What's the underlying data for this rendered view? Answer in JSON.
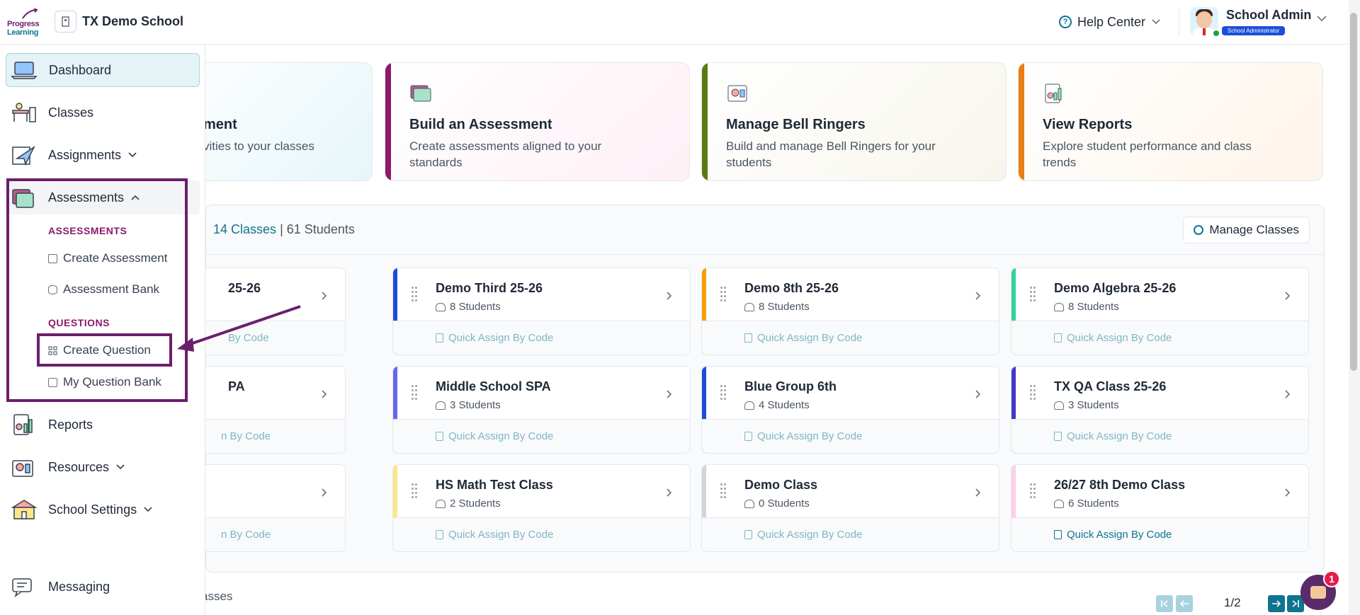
{
  "header": {
    "logo_line1": "Progress",
    "logo_line2": "Learning",
    "school_name": "TX Demo School",
    "help_center": "Help Center",
    "user_name": "School Admin",
    "user_role": "School Administrator"
  },
  "sidebar": {
    "items": [
      {
        "label": "Dashboard"
      },
      {
        "label": "Classes"
      },
      {
        "label": "Assignments"
      },
      {
        "label": "Assessments"
      },
      {
        "label": "Reports"
      },
      {
        "label": "Resources"
      },
      {
        "label": "School Settings"
      },
      {
        "label": "Messaging"
      }
    ],
    "assessments_sub": {
      "heading_assessments": "ASSESSMENTS",
      "create_assessment": "Create Assessment",
      "assessment_bank": "Assessment Bank",
      "heading_questions": "QUESTIONS",
      "create_question": "Create Question",
      "my_question_bank": "My Question Bank"
    }
  },
  "quick_cards": [
    {
      "title": "ment",
      "desc": "vities to your classes",
      "color": "#0e7490"
    },
    {
      "title": "Build an Assessment",
      "desc": "Create assessments aligned to your standards",
      "color": "#8b1a6b"
    },
    {
      "title": "Manage Bell Ringers",
      "desc": "Build and manage Bell Ringers for your students",
      "color": "#5b7a12"
    },
    {
      "title": "View Reports",
      "desc": "Explore student performance and class trends",
      "color": "#ea7d14"
    }
  ],
  "classes": {
    "count_label": "14 Classes",
    "separator": "|",
    "students_label": "61 Students",
    "manage_button": "Manage Classes",
    "quick_assign": "Quick Assign By Code",
    "cards": [
      {
        "name": "25-26",
        "students": "",
        "color": "#0e7490"
      },
      {
        "name": "Demo Third 25-26",
        "students": "8 Students",
        "color": "#1d4ed8"
      },
      {
        "name": "Demo 8th 25-26",
        "students": "8 Students",
        "color": "#f59e0b"
      },
      {
        "name": "Demo Algebra 25-26",
        "students": "8 Students",
        "color": "#34d399"
      },
      {
        "name": "PA",
        "students": "",
        "color": "#0e7490"
      },
      {
        "name": "Middle School SPA",
        "students": "3 Students",
        "color": "#6366f1"
      },
      {
        "name": "Blue Group 6th",
        "students": "4 Students",
        "color": "#1d4ed8"
      },
      {
        "name": "TX QA Class 25-26",
        "students": "3 Students",
        "color": "#4338ca"
      },
      {
        "name": "",
        "students": "",
        "color": "#0e7490"
      },
      {
        "name": "HS Math Test Class",
        "students": "2 Students",
        "color": "#fde68a"
      },
      {
        "name": "Demo Class",
        "students": "0 Students",
        "color": "#d1d5db"
      },
      {
        "name": "26/27 8th Demo Class",
        "students": "6 Students",
        "color": "#fbcfe8"
      }
    ],
    "partial_qa": "n By Code",
    "partial_qa_first": "By Code"
  },
  "footer": {
    "bottom_text": "asses",
    "page_indicator": "1/2"
  },
  "chat": {
    "badge": "1"
  }
}
